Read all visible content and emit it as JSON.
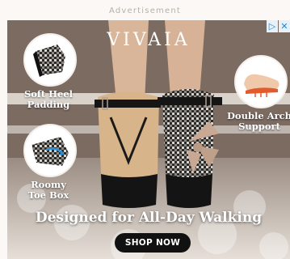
{
  "ad": {
    "label": "Advertisement",
    "brand": "VIVAIA",
    "features": {
      "soft_heel": "Soft Heel\nPadding",
      "roomy_toe": "Roomy\nToe Box",
      "double_arch": "Double Arch\nSupport"
    },
    "headline": "Designed for All-Day Walking",
    "cta_label": "SHOP NOW",
    "adchoices": {
      "info": "▷",
      "close": "✕"
    }
  },
  "colors": {
    "background": "#fbf8f5",
    "cta": "#111111",
    "adchoices": "#1a8ad8"
  }
}
